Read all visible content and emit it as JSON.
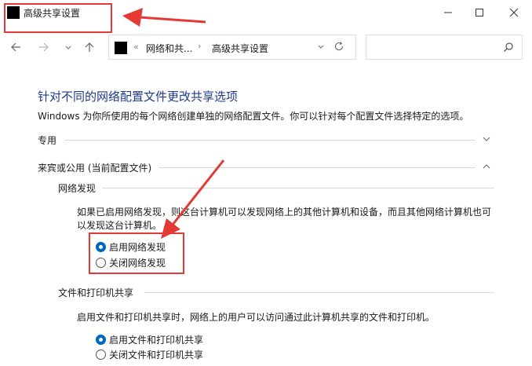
{
  "window": {
    "title": "高级共享设置",
    "controls": {
      "minimize": "—",
      "maximize": "☐",
      "close": "✕"
    }
  },
  "navigation": {
    "back_icon": "arrow-left-icon",
    "forward_icon": "arrow-right-icon",
    "recent_icon": "chevron-down-icon",
    "up_icon": "arrow-up-icon",
    "address": {
      "overflow": "«",
      "crumbs": [
        "网络和共...",
        "高级共享设置"
      ],
      "separator": "›"
    },
    "search": {
      "placeholder": "",
      "icon": "search-icon"
    }
  },
  "content": {
    "heading": "针对不同的网络配置文件更改共享选项",
    "description": "Windows 为你所使用的每个网络创建单独的网络配置文件。你可以针对每个配置文件选择特定的选项。",
    "sections": [
      {
        "label": "专用",
        "expanded": false
      },
      {
        "label": "来宾或公用 (当前配置文件)",
        "expanded": true
      }
    ],
    "network_discovery": {
      "title": "网络发现",
      "text": "如果已启用网络发现，则这台计算机可以发现网络上的其他计算机和设备，而且其他网络计算机也可以发现这台计算机。",
      "options": [
        {
          "label": "启用网络发现",
          "checked": true
        },
        {
          "label": "关闭网络发现",
          "checked": false
        }
      ]
    },
    "file_printer_sharing": {
      "title": "文件和打印机共享",
      "text": "启用文件和打印机共享时，网络上的用户可以访问通过此计算机共享的文件和打印机。",
      "options": [
        {
          "label": "启用文件和打印机共享",
          "checked": true
        },
        {
          "label": "关闭文件和打印机共享",
          "checked": false
        }
      ]
    }
  },
  "colors": {
    "annotation": "#e53935",
    "accent": "#0067c0",
    "heading": "#1e3a8a"
  }
}
